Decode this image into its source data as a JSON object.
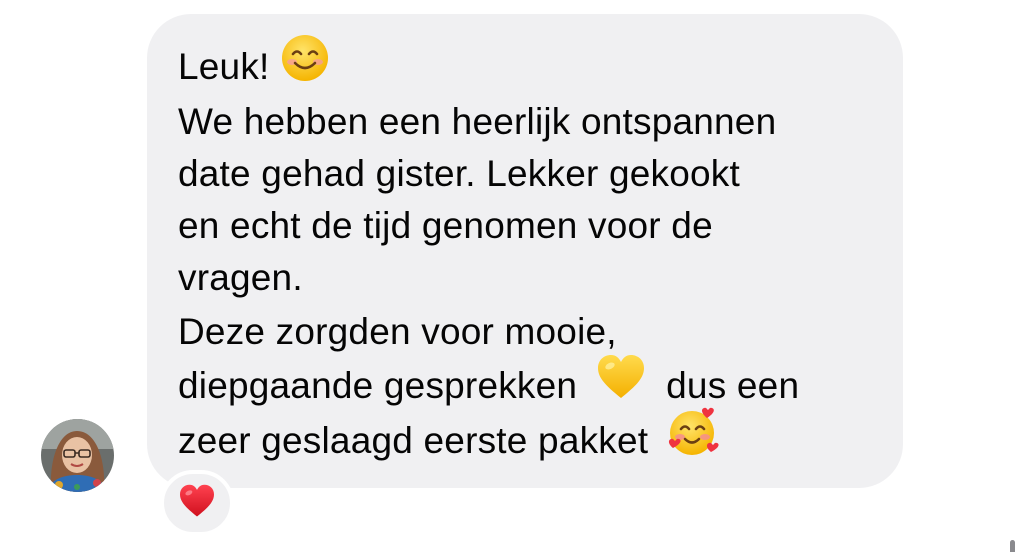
{
  "conversation": {
    "message": {
      "lines": [
        "Leuk!",
        "We hebben een heerlijk ontspannen",
        "date gehad gister. Lekker gekookt",
        "en echt de tijd genomen voor de",
        "vragen.",
        "Deze zorgden voor mooie,",
        "diepgaande gesprekken",
        "dus een",
        "zeer geslaagd eerste pakket"
      ],
      "emojis": [
        "smiling-face",
        "yellow-heart",
        "smiling-face-with-hearts"
      ],
      "reaction_icon": "red-heart"
    },
    "sender": {
      "avatar_icon": "profile-photo"
    }
  },
  "colors": {
    "bubble_background": "#f0f0f2",
    "text": "#050505",
    "reaction_heart": "#e8202f",
    "emoji_yellow": "#ffcc22"
  }
}
